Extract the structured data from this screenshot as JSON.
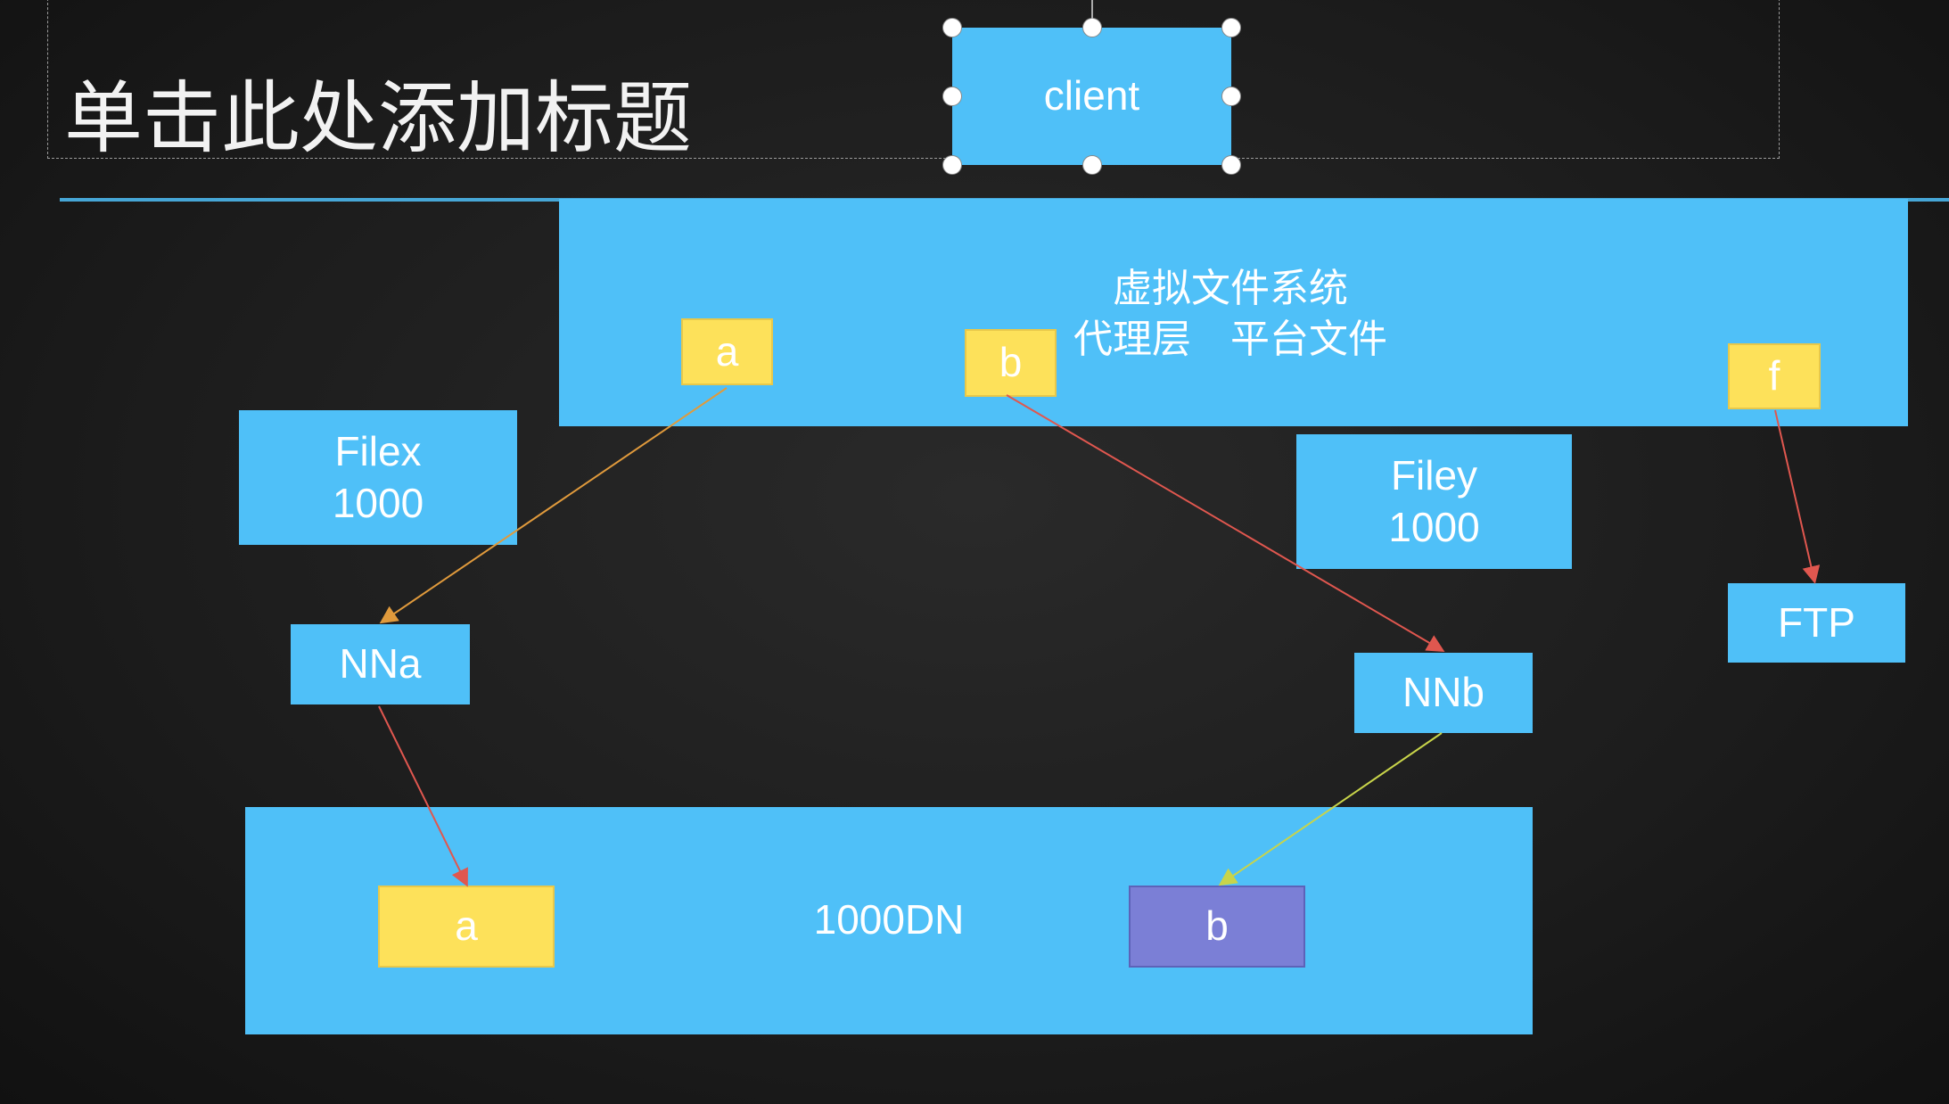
{
  "slide": {
    "title_placeholder": "单击此处添加标题",
    "client": "client",
    "vfs": {
      "line1": "虚拟文件系统",
      "line2": "代理层　平台文件"
    },
    "vfs_items": {
      "a": "a",
      "b": "b",
      "f": "f"
    },
    "filex": {
      "line1": "Filex",
      "line2": "1000"
    },
    "filey": {
      "line1": "Filey",
      "line2": "1000"
    },
    "ftp": "FTP",
    "nna": "NNa",
    "nnb": "NNb",
    "dn": {
      "label": "1000DN",
      "a": "a",
      "b": "b"
    }
  },
  "colors": {
    "blue": "#4fc0f8",
    "yellow": "#fde15a",
    "purple": "#7b7fd6",
    "arrow_red": "#e0574f",
    "arrow_orange": "#e09a3c",
    "arrow_yellowgreen": "#c8d44a"
  }
}
